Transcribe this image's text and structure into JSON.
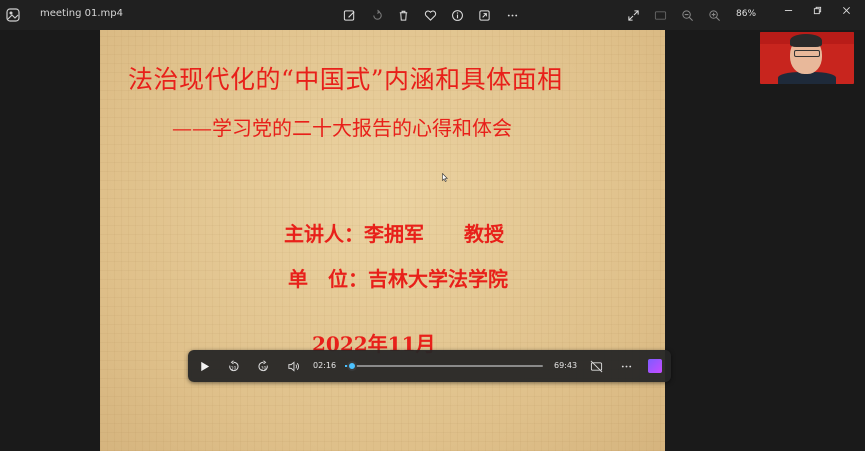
{
  "window": {
    "title": "meeting 01.mp4",
    "zoom_level": "86%"
  },
  "slide": {
    "main_title": "法治现代化的“中国式”内涵和具体面相",
    "subtitle": "——学习党的二十大报告的心得和体会",
    "speaker_line": "主讲人：李拥军　　教授",
    "unit_line": "单　位：吉林大学法学院",
    "date_line": "2022年11月"
  },
  "player": {
    "elapsed": "02:16",
    "duration": "69:43",
    "progress_fraction": 0.033
  },
  "colors": {
    "accent": "#4cc2ff",
    "slide_text": "#e8201a"
  },
  "icons": [
    "photo-app-icon",
    "edit-icon",
    "rotate-icon",
    "delete-icon",
    "favorite-icon",
    "info-icon",
    "share-icon",
    "more-icon",
    "fullscreen-icon",
    "zoom-out-icon",
    "zoom-in-icon",
    "minimize-icon",
    "restore-icon",
    "close-icon",
    "play-icon",
    "rewind-10-icon",
    "forward-30-icon",
    "volume-icon",
    "captions-off-icon",
    "more-options-icon",
    "clipchamp-icon"
  ]
}
